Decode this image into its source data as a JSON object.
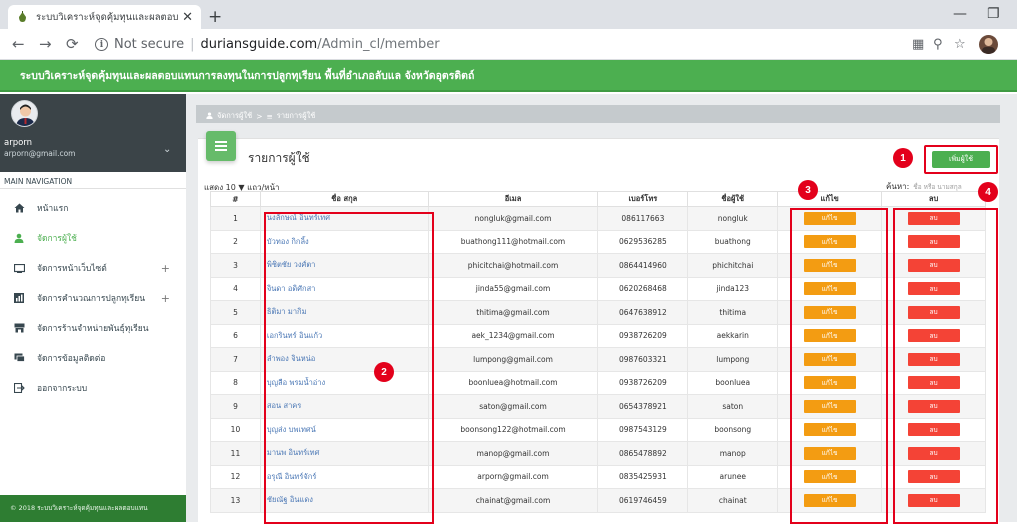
{
  "browser": {
    "tab_title": "ระบบวิเคราะห์จุดคุ้มทุนและผลตอบแทน",
    "url_secure_label": "Not secure",
    "url_host": "duriansguide.com",
    "url_path": "/Admin_cl/member"
  },
  "app": {
    "header_title": "ระบบวิเคราะห์จุดคุ้มทุนและผลตอบแทนการลงทุนในการปลูกทุเรียน พื้นที่อำเภอลับแล จังหวัดอุตรดิตถ์"
  },
  "sidebar": {
    "user_name": "arporn",
    "user_email": "arporn@gmail.com",
    "nav_header": "MAIN NAVIGATION",
    "items": [
      {
        "label": "หน้าแรก",
        "icon": "home-icon",
        "active": false,
        "expandable": false
      },
      {
        "label": "จัดการผู้ใช้",
        "icon": "user-icon",
        "active": true,
        "expandable": false
      },
      {
        "label": "จัดการหน้าเว็บไซต์",
        "icon": "monitor-icon",
        "active": false,
        "expandable": true
      },
      {
        "label": "จัดการคำนวณการปลูกทุเรียน",
        "icon": "chart-icon",
        "active": false,
        "expandable": true
      },
      {
        "label": "จัดการร้านจำหน่ายพันธุ์ทุเรียน",
        "icon": "store-icon",
        "active": false,
        "expandable": false
      },
      {
        "label": "จัดการข้อมูลติดต่อ",
        "icon": "chat-icon",
        "active": false,
        "expandable": false
      },
      {
        "label": "ออกจากระบบ",
        "icon": "logout-icon",
        "active": false,
        "expandable": false
      }
    ],
    "footer": "© 2018 ระบบวิเคราะห์จุดคุ้มทุนและผลตอบแทน"
  },
  "breadcrumb": {
    "home": "จัดการผู้ใช้",
    "separator": ">",
    "current": "รายการผู้ใช้"
  },
  "page": {
    "title": "รายการผู้ใช้",
    "add_button": "เพิ่มผู้ใช้",
    "length_label": "แสดง 10 ▼ แถว/หน้า",
    "search_label": "ค้นหา:",
    "search_placeholder": "ชื่อ หรือ นามสกุล"
  },
  "table": {
    "columns": [
      "#",
      "ชื่อ สกุล",
      "อีเมล",
      "เบอร์โทร",
      "ชื่อผู้ใช้",
      "แก้ไข",
      "ลบ"
    ],
    "edit_label": "แก้ไข",
    "delete_label": "ลบ",
    "rows": [
      {
        "no": "1",
        "name": "นงลักษณ์ อินทร์เทศ",
        "email": "nongluk@gmail.com",
        "phone": "086117663",
        "username": "nongluk"
      },
      {
        "no": "2",
        "name": "บัวทอง กิกลิ้ง",
        "email": "buathong111@hotmail.com",
        "phone": "0629536285",
        "username": "buathong"
      },
      {
        "no": "3",
        "name": "พิชิตชัย วงศ์ตา",
        "email": "phicitchai@hotmail.com",
        "phone": "0864414960",
        "username": "phichitchai"
      },
      {
        "no": "4",
        "name": "จินดา อดิศักสา",
        "email": "jinda55@gmail.com",
        "phone": "0620268468",
        "username": "jinda123"
      },
      {
        "no": "5",
        "name": "ธิติมา มากิม",
        "email": "thitima@gmail.com",
        "phone": "0647638912",
        "username": "thitima"
      },
      {
        "no": "6",
        "name": "เอกรินทร์ อินแก้ว",
        "email": "aek_1234@gmail.com",
        "phone": "0938726209",
        "username": "aekkarin"
      },
      {
        "no": "7",
        "name": "ลำพอง จินหน่อ",
        "email": "lumpong@gmail.com",
        "phone": "0987603321",
        "username": "lumpong"
      },
      {
        "no": "8",
        "name": "บุญลือ พรมน้ำอ่าง",
        "email": "boonluea@hotmail.com",
        "phone": "0938726209",
        "username": "boonluea"
      },
      {
        "no": "9",
        "name": "สอน สาคร",
        "email": "saton@gmail.com",
        "phone": "0654378921",
        "username": "saton"
      },
      {
        "no": "10",
        "name": "บุญส่ง บพเทศน์",
        "email": "boonsong122@hotmail.com",
        "phone": "0987543129",
        "username": "boonsong"
      },
      {
        "no": "11",
        "name": "มานพ อินทร์เทศ",
        "email": "manop@gmail.com",
        "phone": "0865478892",
        "username": "manop"
      },
      {
        "no": "12",
        "name": "อรุณี อินทร์จักร์",
        "email": "arporn@gmail.com",
        "phone": "0835425931",
        "username": "arunee"
      },
      {
        "no": "13",
        "name": "ชัยณัฐ อินแดง",
        "email": "chainat@gmail.com",
        "phone": "0619746459",
        "username": "chainat"
      }
    ]
  },
  "annotations": [
    "1",
    "2",
    "3",
    "4"
  ],
  "colors": {
    "header_green": "#4caf50",
    "edit_orange": "#f39c12",
    "delete_red": "#f44336",
    "annotation_red": "#e3001b"
  }
}
